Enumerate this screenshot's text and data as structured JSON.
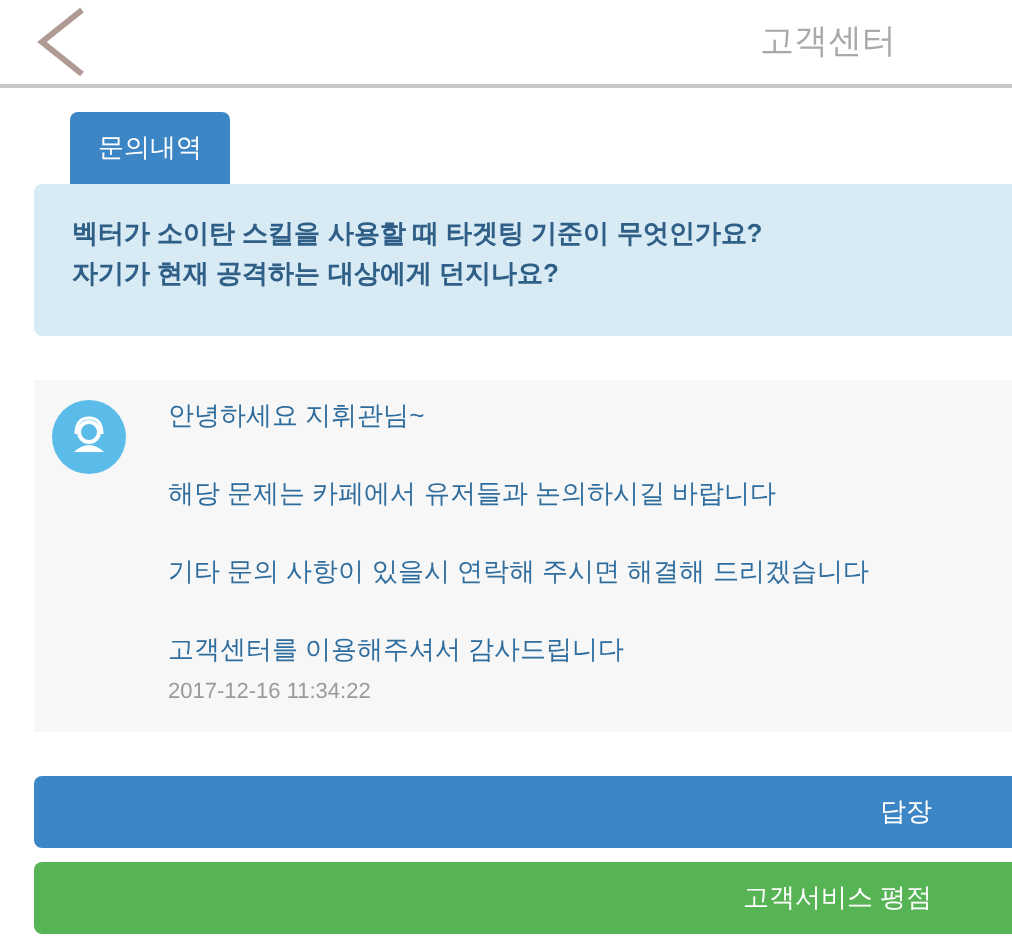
{
  "header": {
    "title": "고객센터"
  },
  "tab": {
    "label": "문의내역"
  },
  "question": [
    "벡터가 소이탄 스킬을 사용할 때 타겟팅 기준이 무엇인가요?",
    "자기가 현재 공격하는 대상에게 던지나요?"
  ],
  "reply": {
    "lines": [
      "안녕하세요 지휘관님~",
      "해당 문제는  카페에서 유저들과 논의하시길 바랍니다",
      "기타 문의 사항이 있을시 연락해 주시면 해결해 드리겠습니다",
      "고객센터를 이용해주셔서 감사드립니다"
    ],
    "timestamp": "2017-12-16 11:34:22"
  },
  "buttons": [
    {
      "label": "답장",
      "kind": "reply"
    },
    {
      "label": "고객서비스 평점",
      "kind": "rate"
    }
  ]
}
